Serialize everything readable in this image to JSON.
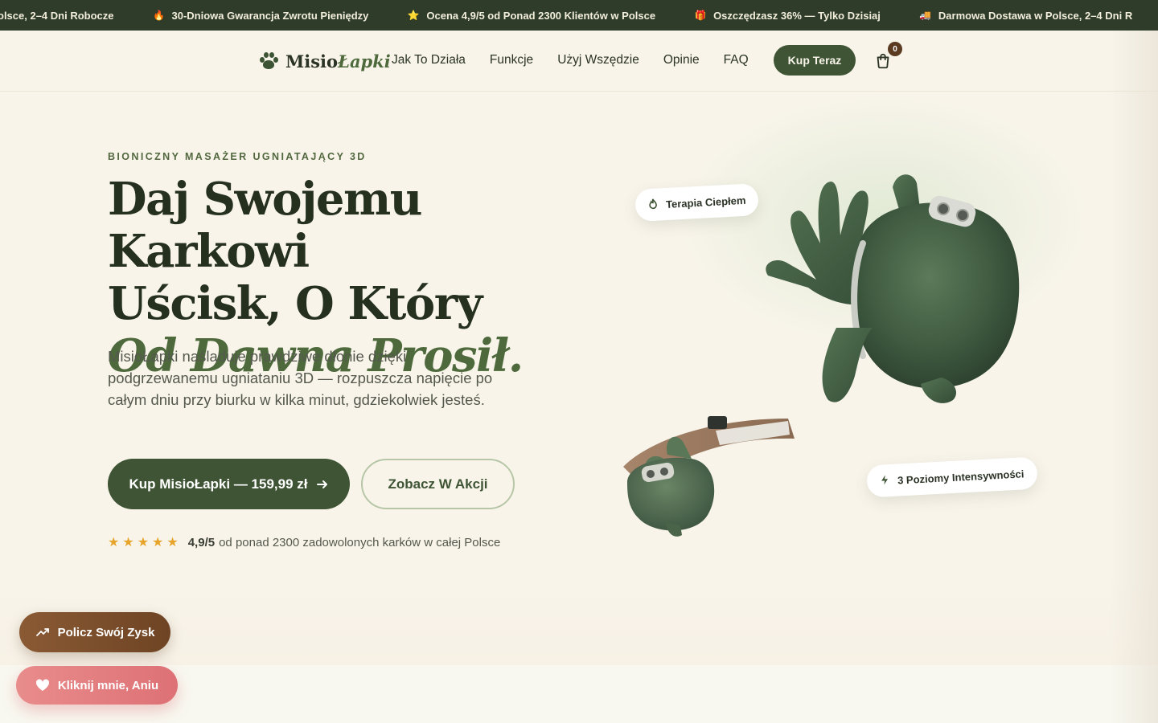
{
  "ticker": {
    "items": [
      {
        "icon": "truck-icon",
        "emoji": "",
        "text": "olsce, 2–4 Dni Robocze"
      },
      {
        "icon": "fire-icon",
        "emoji": "🔥",
        "text": "30-Dniowa Gwarancja Zwrotu Pieniędzy"
      },
      {
        "icon": "star-icon",
        "emoji": "⭐",
        "text": "Ocena 4,9/5 od Ponad 2300 Klientów w Polsce"
      },
      {
        "icon": "gift-icon",
        "emoji": "🎁",
        "text": "Oszczędzasz 36% — Tylko Dzisiaj"
      },
      {
        "icon": "truck-icon",
        "emoji": "🚚",
        "text": "Darmowa Dostawa w Polsce, 2–4 Dni R"
      }
    ]
  },
  "header": {
    "logo_main": "Misio",
    "logo_accent": "Łapki",
    "nav": [
      "Jak To Działa",
      "Funkcje",
      "Użyj Wszędzie",
      "Opinie",
      "FAQ"
    ],
    "buy_label": "Kup Teraz",
    "cart_count": "0"
  },
  "hero": {
    "eyebrow": "BIONICZNY MASAŻER UGNIATAJĄCY 3D",
    "title_line1": "Daj Swojemu Karkowi",
    "title_line2": "Uścisk, O Który",
    "title_italic": "Od Dawna Prosił.",
    "lead": "MisioŁapki naśladuje prawdziwe dłonie dzięki podgrzewanemu ugniataniu 3D — rozpuszcza napięcie po całym dniu przy biurku w kilka minut, gdziekolwiek jesteś.",
    "cta_primary": "Kup MisioŁapki — 159,99 zł",
    "cta_secondary": "Zobacz W Akcji",
    "rating_score": "4,9/5",
    "rating_text": "od ponad 2300 zadowolonych karków w całej Polsce",
    "stars": 5
  },
  "badges": {
    "heat": "Terapia Ciepłem",
    "intensity": "3 Poziomy Intensywności"
  },
  "floating": {
    "profit_label": "Policz Swój Zysk",
    "love_label": "Kliknij mnie, Aniu"
  },
  "colors": {
    "brand_green": "#3e5434",
    "accent_green": "#4e6a3c",
    "ticker_bg": "#2f3c2a",
    "star": "#e6a52a",
    "profit_btn": "#7a4e2c",
    "love_btn": "#e27d80"
  }
}
